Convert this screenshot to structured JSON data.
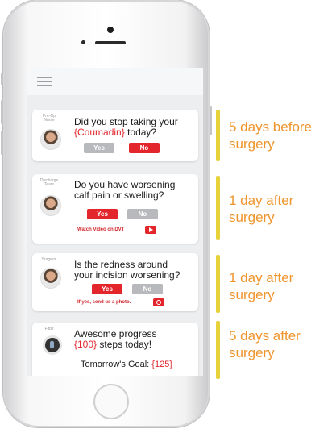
{
  "app": {
    "cards": [
      {
        "role": "Pre-Op Nurse",
        "question_pre": "Did you stop taking your",
        "highlight": "{Coumadin}",
        "question_post": "today?",
        "yes_label": "Yes",
        "no_label": "No",
        "selected": "No"
      },
      {
        "role": "Discharge Team",
        "question_line1": "Do you have worsening",
        "question_line2": "calf pain or swelling?",
        "yes_label": "Yes",
        "no_label": "No",
        "selected": "Yes",
        "link_text": "Watch Video on DVT",
        "link_icon": "play-video-icon"
      },
      {
        "role": "Surgeon",
        "question_line1": "Is the redness around",
        "question_line2": "your incision worsening?",
        "yes_label": "Yes",
        "no_label": "No",
        "selected": "Yes",
        "link_text": "If yes, send us a photo.",
        "link_icon": "camera-icon"
      },
      {
        "role": "Fitbit",
        "line1": "Awesome progress",
        "steps": "{100}",
        "steps_suffix": "steps today!",
        "goal_label": "Tomorrow's Goal:",
        "goal_value": "{125}"
      }
    ]
  },
  "annotations": [
    {
      "line1": "5 days before",
      "line2": "surgery"
    },
    {
      "line1": "1 day after",
      "line2": "surgery"
    },
    {
      "line1": "1 day after",
      "line2": "surgery"
    },
    {
      "line1": "5 days after",
      "line2": "surgery"
    }
  ],
  "colors": {
    "accent_red": "#e2262c",
    "annotation_orange": "#f0952e",
    "annotation_bar": "#e8d23a"
  }
}
